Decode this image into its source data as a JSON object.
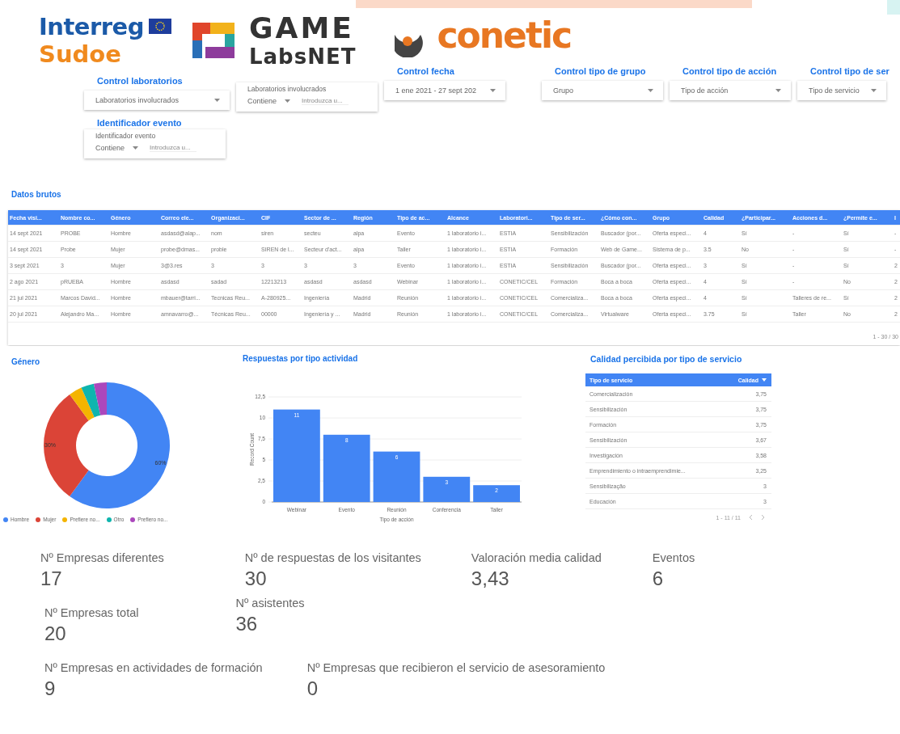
{
  "logos": {
    "interreg": {
      "name": "Interreg",
      "sub": "Sudoe"
    },
    "game": {
      "name": "GAME",
      "sub": "LabsNET"
    },
    "conetic": {
      "name": "conetic"
    }
  },
  "controls": [
    {
      "kind": "dropdown",
      "title": "Control laboratorios",
      "value": "Laboratorios involucrados"
    },
    {
      "kind": "filter",
      "label": "Laboratorios involucrados",
      "operator": "Contiene",
      "placeholder": "Introduzca u..."
    },
    {
      "kind": "dropdown",
      "title": "Control fecha",
      "value": "1 ene 2021 - 27 sept 202"
    },
    {
      "kind": "dropdown",
      "title": "Control tipo de grupo",
      "value": "Grupo"
    },
    {
      "kind": "dropdown",
      "title": "Control tipo de acción",
      "value": "Tipo de acción"
    },
    {
      "kind": "dropdown",
      "title": "Control tipo de ser",
      "value": "Tipo de servicio"
    },
    {
      "kind": "filter",
      "title": "Identificador evento",
      "label": "Identificador evento",
      "operator": "Contiene",
      "placeholder": "Introduzca u..."
    }
  ],
  "raw_table": {
    "title": "Datos brutos",
    "columns": [
      "Fecha visi...",
      "Nombre co...",
      "Género",
      "Correo ele...",
      "Organizaci...",
      "CIF",
      "Sector de ...",
      "Región",
      "Tipo de ac...",
      "Alcance",
      "Laboratori...",
      "Tipo de ser...",
      "¿Cómo con...",
      "Grupo",
      "Calidad",
      "¿Participar...",
      "Acciones d...",
      "¿Permite e...",
      "I"
    ],
    "rows": [
      [
        "14 sept 2021",
        "PROBE",
        "Hombre",
        "asdasd@alap...",
        "nom",
        "siren",
        "secteu",
        "alpa",
        "Evento",
        "1 laboratorio i...",
        "ESTIA",
        "Sensibilización",
        "Buscador (por...",
        "Oferta especi...",
        "4",
        "Sí",
        "-",
        "Sí",
        "-"
      ],
      [
        "14 sept 2021",
        "Probe",
        "Mujer",
        "probe@dmas...",
        "proble",
        "SIREN de l...",
        "Secteur d'act...",
        "alpa",
        "Taller",
        "1 laboratorio i...",
        "ESTIA",
        "Formación",
        "Web de Game...",
        "Sistema de p...",
        "3.5",
        "No",
        "-",
        "Sí",
        "-"
      ],
      [
        "3 sept 2021",
        "3",
        "Mujer",
        "3@3.res",
        "3",
        "3",
        "3",
        "3",
        "Evento",
        "1 laboratorio i...",
        "ESTIA",
        "Sensibilización",
        "Buscador (por...",
        "Oferta especi...",
        "3",
        "Sí",
        "-",
        "Sí",
        "2"
      ],
      [
        "2 ago 2021",
        "pRUEBA",
        "Hombre",
        "asdasd",
        "sadad",
        "12213213",
        "asdasd",
        "asdasd",
        "Webinar",
        "1 laboratorio i...",
        "CONETIC/CEL",
        "Formación",
        "Boca a boca",
        "Oferta especi...",
        "4",
        "Sí",
        "-",
        "No",
        "2"
      ],
      [
        "21 jul 2021",
        "Marcos David...",
        "Hombre",
        "mbauer@tarri...",
        "Tecnicas Reu...",
        "A-280925...",
        "Ingeniería",
        "Madrid",
        "Reunión",
        "1 laboratorio i...",
        "CONETIC/CEL",
        "Comercializa...",
        "Boca a boca",
        "Oferta especi...",
        "4",
        "Sí",
        "Talleres de re...",
        "Sí",
        "2"
      ],
      [
        "20 jul 2021",
        "Alejandro Ma...",
        "Hombre",
        "amnavarro@...",
        "Técnicas Reu...",
        "00000",
        "Ingeniería y ...",
        "Madrid",
        "Reunión",
        "1 laboratorio i...",
        "CONETIC/CEL",
        "Comercializa...",
        "Virtualware",
        "Oferta especi...",
        "3.75",
        "Sí",
        "Taller",
        "No",
        "2"
      ]
    ],
    "pagination": "1 - 30 / 30"
  },
  "gender_chart": {
    "title": "Género",
    "chart_data": {
      "type": "donut",
      "categories": [
        "Hombre",
        "Mujer",
        "Prefiere no...",
        "Otro",
        "Prefiero no..."
      ],
      "series": [
        {
          "values": [
            60,
            30,
            3.4,
            3.3,
            3.3
          ]
        }
      ],
      "legend": true,
      "colors": [
        "#4285f4",
        "#db4437",
        "#f4b400",
        "#0fb5ae",
        "#ab47bc"
      ],
      "value_labels": [
        "60%",
        "30%",
        null,
        null,
        null
      ]
    }
  },
  "activity_chart": {
    "title": "Respuestas por tipo actividad",
    "chart_data": {
      "type": "bar",
      "xlabel": "Tipo de acción",
      "ylabel": "Record Count",
      "categories": [
        "Webinar",
        "Evento",
        "Reunión",
        "Conferencia",
        "Taller"
      ],
      "series": [
        {
          "color": "#4285f4",
          "values": [
            11,
            8,
            6,
            3,
            2
          ]
        }
      ],
      "grid": true,
      "ylim": [
        0,
        12.5
      ],
      "yticks": [
        {
          "value": 0,
          "label": "0"
        },
        {
          "value": 2.5,
          "label": "2,5"
        },
        {
          "value": 5,
          "label": "5"
        },
        {
          "value": 7.5,
          "label": "7,5"
        },
        {
          "value": 10,
          "label": "10"
        },
        {
          "value": 12.5,
          "label": "12,5"
        }
      ],
      "data_labels": true
    }
  },
  "quality_table": {
    "title": "Calidad percibida por tipo de servicio",
    "columns": [
      "Tipo de servicio",
      "Calidad"
    ],
    "rows": [
      [
        "Comercialización",
        "3,75"
      ],
      [
        "Sensibilización",
        "3,75"
      ],
      [
        "Formación",
        "3,75"
      ],
      [
        "Sensibilización",
        "3,67"
      ],
      [
        "Investigación",
        "3,58"
      ],
      [
        "Emprendimiento o intraemprendimie...",
        "3,25"
      ],
      [
        "Sensibilização",
        "3"
      ],
      [
        "Educación",
        "3"
      ]
    ],
    "pagination": "1 - 11 / 11"
  },
  "kpis": [
    {
      "label": "Nº Empresas diferentes",
      "value": "17"
    },
    {
      "label": "Nº de respuestas de los visitantes",
      "value": "30"
    },
    {
      "label": "Valoración media calidad",
      "value": "3,43"
    },
    {
      "label": "Eventos",
      "value": "6"
    },
    {
      "label": "Nº Empresas total",
      "value": "20"
    },
    {
      "label": "Nº asistentes",
      "value": "36"
    },
    {
      "label": "Nº Empresas en actividades de formación",
      "value": "9"
    },
    {
      "label": "Nº Empresas que recibieron el servicio de asesoramiento",
      "value": "0"
    }
  ]
}
